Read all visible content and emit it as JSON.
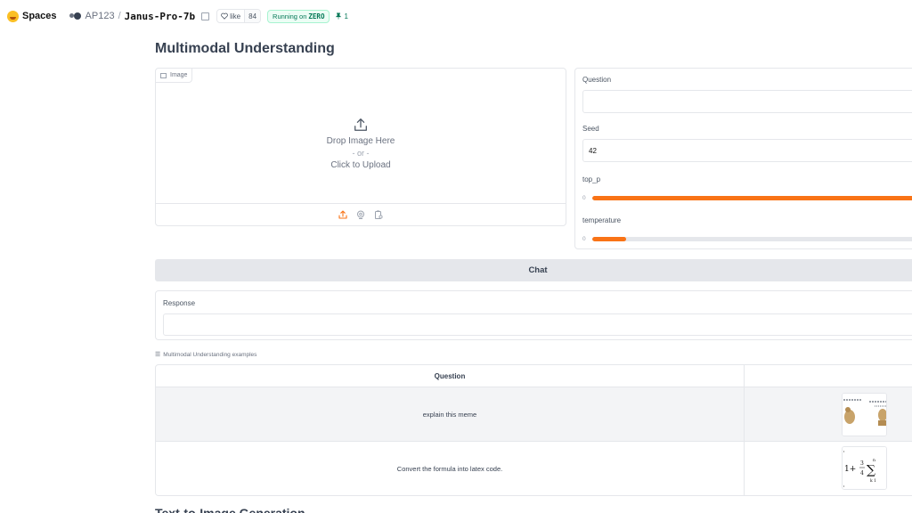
{
  "topbar": {
    "spaces_label": "Spaces",
    "owner": "AP123",
    "separator": "/",
    "repo": "Janus-Pro-7b",
    "like_label": "like",
    "like_count": "84",
    "running_prefix": "Running on",
    "running_hardware": "ZERO",
    "pin_count": "1"
  },
  "page": {
    "title": "Multimodal Understanding"
  },
  "image_input": {
    "tag_label": "Image",
    "drop_text": "Drop Image Here",
    "or_text": "- or -",
    "click_text": "Click to Upload",
    "tools": [
      "upload-icon",
      "webcam-icon",
      "clipboard-icon"
    ]
  },
  "controls": {
    "question_label": "Question",
    "question_value": "",
    "seed_label": "Seed",
    "seed_value": "42",
    "top_p": {
      "label": "top_p",
      "min_label": "0",
      "fraction": 0.95
    },
    "temperature": {
      "label": "temperature",
      "min_label": "0",
      "fraction": 0.1
    }
  },
  "chat_button": {
    "label": "Chat"
  },
  "response": {
    "label": "Response",
    "value": ""
  },
  "examples": {
    "label": "Multimodal Understanding examples",
    "columns": [
      "Question",
      ""
    ],
    "rows": [
      {
        "question": "explain this meme",
        "thumbnail": "meme-thumbnail"
      },
      {
        "question": "Convert the formula into latex code.",
        "thumbnail": "formula-thumbnail"
      }
    ]
  },
  "next_section": {
    "title": "Text-to-Image Generation"
  },
  "colors": {
    "accent": "#f97316",
    "running_bg": "#ecfdf5",
    "running_text": "#047857"
  }
}
